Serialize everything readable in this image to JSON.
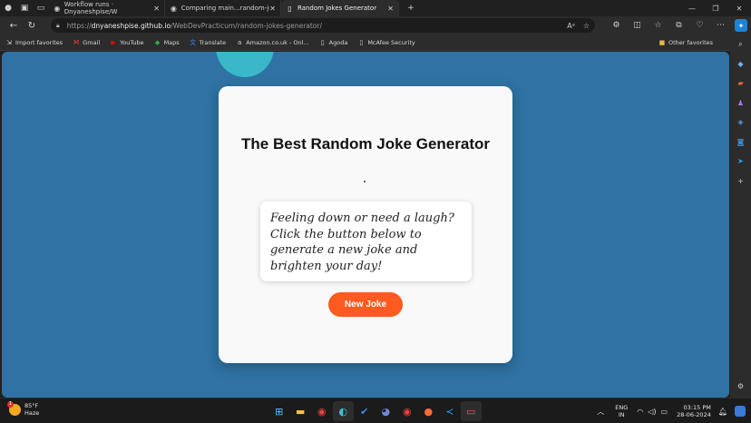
{
  "browser": {
    "tabs": [
      {
        "label": "Workflow runs · Dnyaneshpise/W",
        "favicon": "github-icon",
        "active": false
      },
      {
        "label": "Comparing main...random-jokes",
        "favicon": "github-icon",
        "active": false
      },
      {
        "label": "Random Jokes Generator",
        "favicon": "page-icon",
        "active": true
      }
    ],
    "url": {
      "protocol": "https://",
      "host": "dnyaneshpise.github.io",
      "path": "/WebDevPracticum/random-jokes-generator/"
    },
    "url_actions": {
      "read_aloud": "Aᵃ"
    },
    "favorites": [
      {
        "label": "Import favorites",
        "icon": "import-icon"
      },
      {
        "label": "Gmail",
        "icon": "gmail-icon"
      },
      {
        "label": "YouTube",
        "icon": "youtube-icon"
      },
      {
        "label": "Maps",
        "icon": "maps-icon"
      },
      {
        "label": "Translate",
        "icon": "translate-icon"
      },
      {
        "label": "Amazon.co.uk - Onl...",
        "icon": "amazon-icon"
      },
      {
        "label": "Agoda",
        "icon": "page-icon"
      },
      {
        "label": "McAfee Security",
        "icon": "page-icon"
      }
    ],
    "other_favorites": "Other favorites"
  },
  "page": {
    "title": "The Best Random Joke Generator",
    "joke_text": "Feeling down or need a laugh? Click the button below to generate a new joke and brighten your day!",
    "button_label": "New Joke",
    "colors": {
      "background": "#2f72a3",
      "card": "#f9f9f9",
      "accent": "#ff5a1f",
      "circle": "#3ab8c9"
    }
  },
  "taskbar": {
    "weather": {
      "temp": "85°F",
      "condition": "Haze",
      "badge": "1"
    },
    "language": {
      "lang": "ENG",
      "region": "IN"
    },
    "time": "03:15 PM",
    "date": "28-06-2024"
  }
}
